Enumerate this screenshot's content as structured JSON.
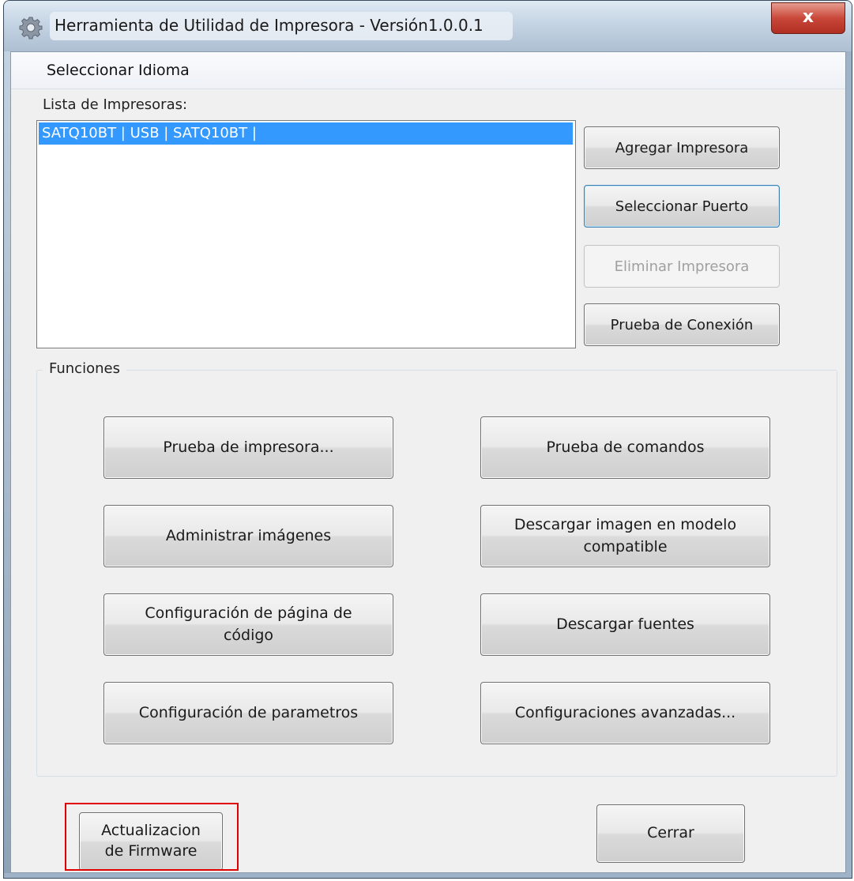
{
  "window": {
    "title": "Herramienta de Utilidad de Impresora - Versión1.0.0.1",
    "close_glyph": "x"
  },
  "menu": {
    "language": "Seleccionar Idioma"
  },
  "printers": {
    "label": "Lista de Impresoras:",
    "items": [
      "SATQ10BT | USB | SATQ10BT |"
    ],
    "selected_index": 0
  },
  "printer_buttons": {
    "add": "Agregar Impresora",
    "select_port": "Seleccionar Puerto",
    "remove": "Eliminar Impresora",
    "test_connection": "Prueba de Conexión"
  },
  "functions": {
    "label": "Funciones",
    "printer_test": "Prueba de impresora...",
    "command_test": "Prueba de comandos",
    "manage_images": "Administrar imágenes",
    "download_image_line1": "Descargar imagen en modelo",
    "download_image_line2": "compatible",
    "codepage_line1": "Configuración de página de",
    "codepage_line2": "código",
    "download_fonts": "Descargar fuentes",
    "parameters": "Configuración de parametros",
    "advanced": "Configuraciones avanzadas..."
  },
  "footer": {
    "firmware_line1": "Actualizacion",
    "firmware_line2": "de Firmware",
    "close": "Cerrar"
  },
  "colors": {
    "selection": "#3399ff",
    "highlight_box": "#e00000",
    "close_button": "#c9483a"
  },
  "icons": {
    "app": "gear-icon"
  }
}
